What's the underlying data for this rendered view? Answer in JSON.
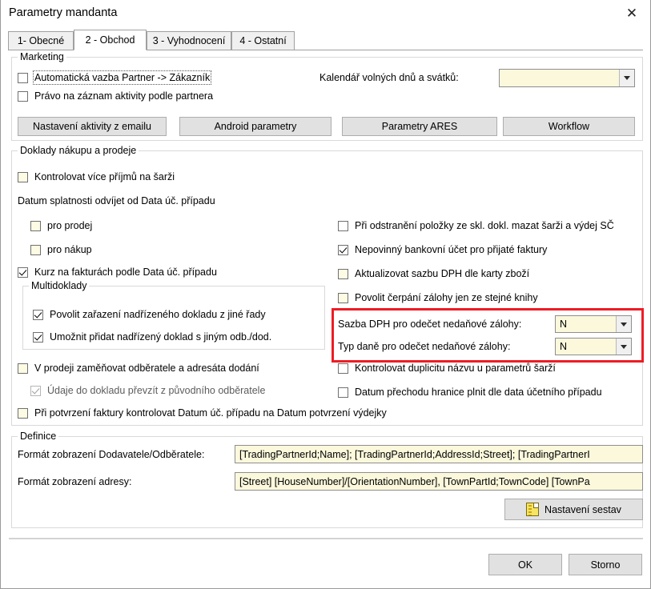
{
  "window": {
    "title": "Parametry mandanta",
    "close_icon": "close-icon"
  },
  "tabs": [
    {
      "label": "1- Obecné",
      "active": false
    },
    {
      "label": "2 - Obchod",
      "active": true
    },
    {
      "label": "3 - Vyhodnocení",
      "active": false
    },
    {
      "label": "4 - Ostatní",
      "active": false
    }
  ],
  "marketing": {
    "title": "Marketing",
    "cb_auto_link": "Automatická vazba Partner -> Zákazník",
    "cb_activity_right": "Právo na záznam aktivity podle partnera",
    "calendar_label": "Kalendář volných dnů a svátků:",
    "calendar_value": "",
    "buttons": {
      "email_activity": "Nastavení aktivity z emailu",
      "android": "Android parametry",
      "ares": "Parametry ARES",
      "workflow": "Workflow"
    }
  },
  "documents": {
    "title": "Doklady nákupu a prodeje",
    "cb_control_more_receipts": "Kontrolovat více příjmů na šarži",
    "due_date_label": "Datum splatnosti odvíjet od Data úč. případu",
    "cb_for_sale": "pro prodej",
    "cb_for_purchase": "pro nákup",
    "cb_rate_invoices": "Kurz na fakturách podle Data úč. případu",
    "multidocs": {
      "title": "Multidoklady",
      "cb_allow_parent_other_series": "Povolit zařazení nadřízeného dokladu z jiné řady",
      "cb_allow_parent_other_customer": "Umožnit přidat nadřízený doklad s jiným odb./dod."
    },
    "cb_delete_batch": "Při odstranění položky ze skl. dokl. mazat šarži a výdej SČ",
    "cb_optional_bank_account": "Nepovinný bankovní účet pro přijaté faktury",
    "cb_update_vat_rate": "Aktualizovat sazbu DPH dle karty zboží",
    "cb_allow_advance_same_book": "Povolit čerpání zálohy jen ze stejné knihy",
    "vat_rate_label": "Sazba DPH pro odečet nedaňové zálohy:",
    "vat_rate_value": "N",
    "tax_type_label": "Typ daně pro odečet nedaňové zálohy:",
    "tax_type_value": "N",
    "cb_swap_customer": "V prodeji zaměňovat odběratele a adresáta dodání",
    "cb_take_data_from_original": "Údaje do dokladu převzít z původního odběratele",
    "cb_check_invoice_confirm": "Při potvrzení faktury kontrolovat Datum úč. případu na Datum potvrzení výdejky",
    "cb_check_duplicity": "Kontrolovat duplicitu názvu u parametrů šarží",
    "cb_border_crossing_date": "Datum přechodu hranice plnit dle data účetního případu"
  },
  "definitions": {
    "title": "Definice",
    "supplier_format_label": "Formát zobrazení Dodavatele/Odběratele:",
    "supplier_format_value": "[TradingPartnerId;Name]; [TradingPartnerId;AddressId;Street]; [TradingPartnerI",
    "address_format_label": "Formát zobrazení adresy:",
    "address_format_value": "[Street] [HouseNumber]/[OrientationNumber], [TownPartId;TownCode]  [TownPa",
    "reports_button": "Nastavení sestav",
    "reports_icon": "report-document-icon"
  },
  "footer": {
    "ok": "OK",
    "cancel": "Storno"
  },
  "colors": {
    "highlight": "#ee1c25",
    "field_background": "#fbf8dc",
    "button_face": "#e1e1e1"
  }
}
